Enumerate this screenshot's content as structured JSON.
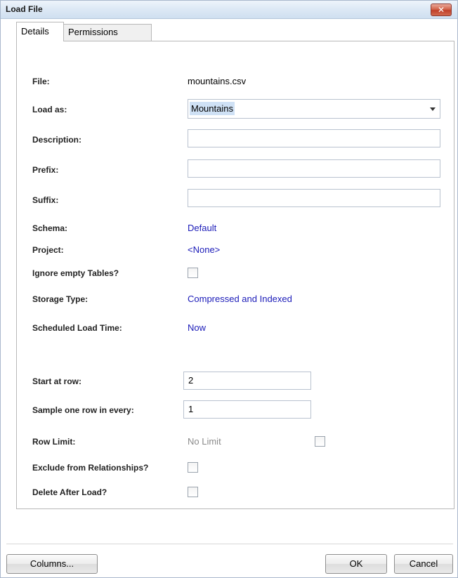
{
  "window": {
    "title": "Load File",
    "close_glyph": "✕"
  },
  "tabs": [
    {
      "label": "Details"
    },
    {
      "label": "Permissions"
    }
  ],
  "form": {
    "file": {
      "label": "File:",
      "value": "mountains.csv"
    },
    "load_as": {
      "label": "Load as:",
      "value": "Mountains"
    },
    "description": {
      "label": "Description:",
      "value": ""
    },
    "prefix": {
      "label": "Prefix:",
      "value": ""
    },
    "suffix": {
      "label": "Suffix:",
      "value": ""
    },
    "schema": {
      "label": "Schema:",
      "value": "Default"
    },
    "project": {
      "label": "Project:",
      "value": "<None>"
    },
    "ignore_empty": {
      "label": "Ignore empty Tables?",
      "checked": false
    },
    "storage_type": {
      "label": "Storage Type:",
      "value": "Compressed and Indexed"
    },
    "scheduled_load_time": {
      "label": "Scheduled Load Time:",
      "value": "Now"
    },
    "start_at_row": {
      "label": "Start at row:",
      "value": "2"
    },
    "sample_row": {
      "label": "Sample one row in every:",
      "value": "1"
    },
    "row_limit": {
      "label": "Row Limit:",
      "value": "No Limit",
      "checked": false
    },
    "exclude_relationships": {
      "label": "Exclude from Relationships?",
      "checked": false
    },
    "delete_after_load": {
      "label": "Delete After Load?",
      "checked": false
    }
  },
  "buttons": {
    "columns": "Columns...",
    "ok": "OK",
    "cancel": "Cancel"
  },
  "colors": {
    "link": "#1a1ab8",
    "disabled_text": "#8a8a8a",
    "selection": "#cfe1f5"
  }
}
